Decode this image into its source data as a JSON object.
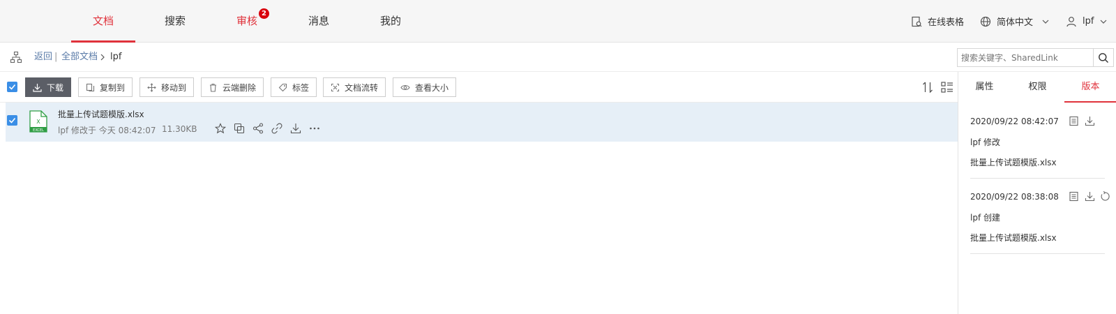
{
  "nav": {
    "tabs": [
      {
        "label": "文档"
      },
      {
        "label": "搜索"
      },
      {
        "label": "审核",
        "badge": "2"
      },
      {
        "label": "消息"
      },
      {
        "label": "我的"
      }
    ],
    "online_sheet": "在线表格",
    "language": "简体中文",
    "user": "lpf"
  },
  "breadcrumb": {
    "back": "返回",
    "divider": "|",
    "all_docs": "全部文档",
    "current": "lpf"
  },
  "search": {
    "placeholder": "搜索关键字、SharedLink"
  },
  "toolbar": {
    "download": "下载",
    "copy_to": "复制到",
    "move_to": "移动到",
    "cloud_delete": "云端删除",
    "tag": "标签",
    "doc_flow": "文档流转",
    "view_size": "查看大小"
  },
  "file": {
    "name": "批量上传试题模版.xlsx",
    "modified": "lpf 修改于 今天 08:42:07",
    "size": "11.30KB",
    "icon_letter": "X",
    "icon_label": "EXCEL"
  },
  "panel": {
    "tabs": [
      "属性",
      "权限",
      "版本"
    ],
    "versions": [
      {
        "time": "2020/09/22 08:42:07",
        "action": "lpf 修改",
        "file": "批量上传试题模版.xlsx"
      },
      {
        "time": "2020/09/22 08:38:08",
        "action": "lpf 创建",
        "file": "批量上传试题模版.xlsx"
      }
    ]
  },
  "colors": {
    "accent": "#e0323b",
    "checkbox": "#3a8ee6",
    "row_selected": "#e6eff7",
    "excel": "#2f9e44"
  }
}
